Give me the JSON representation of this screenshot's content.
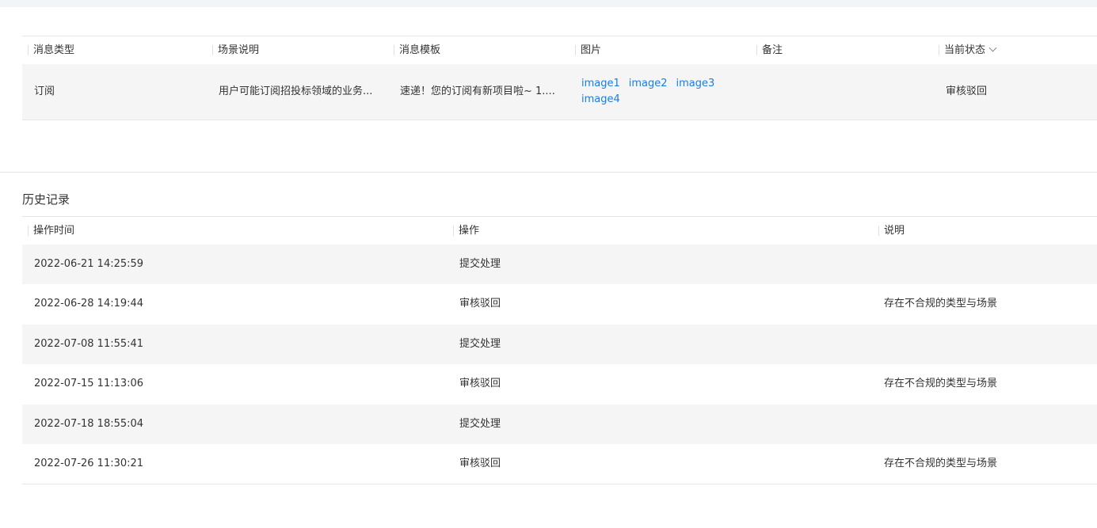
{
  "message_table": {
    "headers": {
      "type": "消息类型",
      "scene": "场景说明",
      "template": "消息模板",
      "images": "图片",
      "remark": "备注",
      "status": "当前状态"
    },
    "row": {
      "type": "订阅",
      "scene": "用户可能订阅招投标领域的业务...",
      "template": "速递！您的订阅有新项目啦~ 1....",
      "images": [
        "image1",
        "image2",
        "image3",
        "image4"
      ],
      "remark": "",
      "status": "审核驳回"
    }
  },
  "history": {
    "title": "历史记录",
    "headers": {
      "time": "操作时间",
      "action": "操作",
      "note": "说明"
    },
    "rows": [
      {
        "time": "2022-06-21 14:25:59",
        "action": "提交处理",
        "note": ""
      },
      {
        "time": "2022-06-28 14:19:44",
        "action": "审核驳回",
        "note": "存在不合规的类型与场景"
      },
      {
        "time": "2022-07-08 11:55:41",
        "action": "提交处理",
        "note": ""
      },
      {
        "time": "2022-07-15 11:13:06",
        "action": "审核驳回",
        "note": "存在不合规的类型与场景"
      },
      {
        "time": "2022-07-18 18:55:04",
        "action": "提交处理",
        "note": ""
      },
      {
        "time": "2022-07-26 11:30:21",
        "action": "审核驳回",
        "note": "存在不合规的类型与场景"
      }
    ]
  }
}
